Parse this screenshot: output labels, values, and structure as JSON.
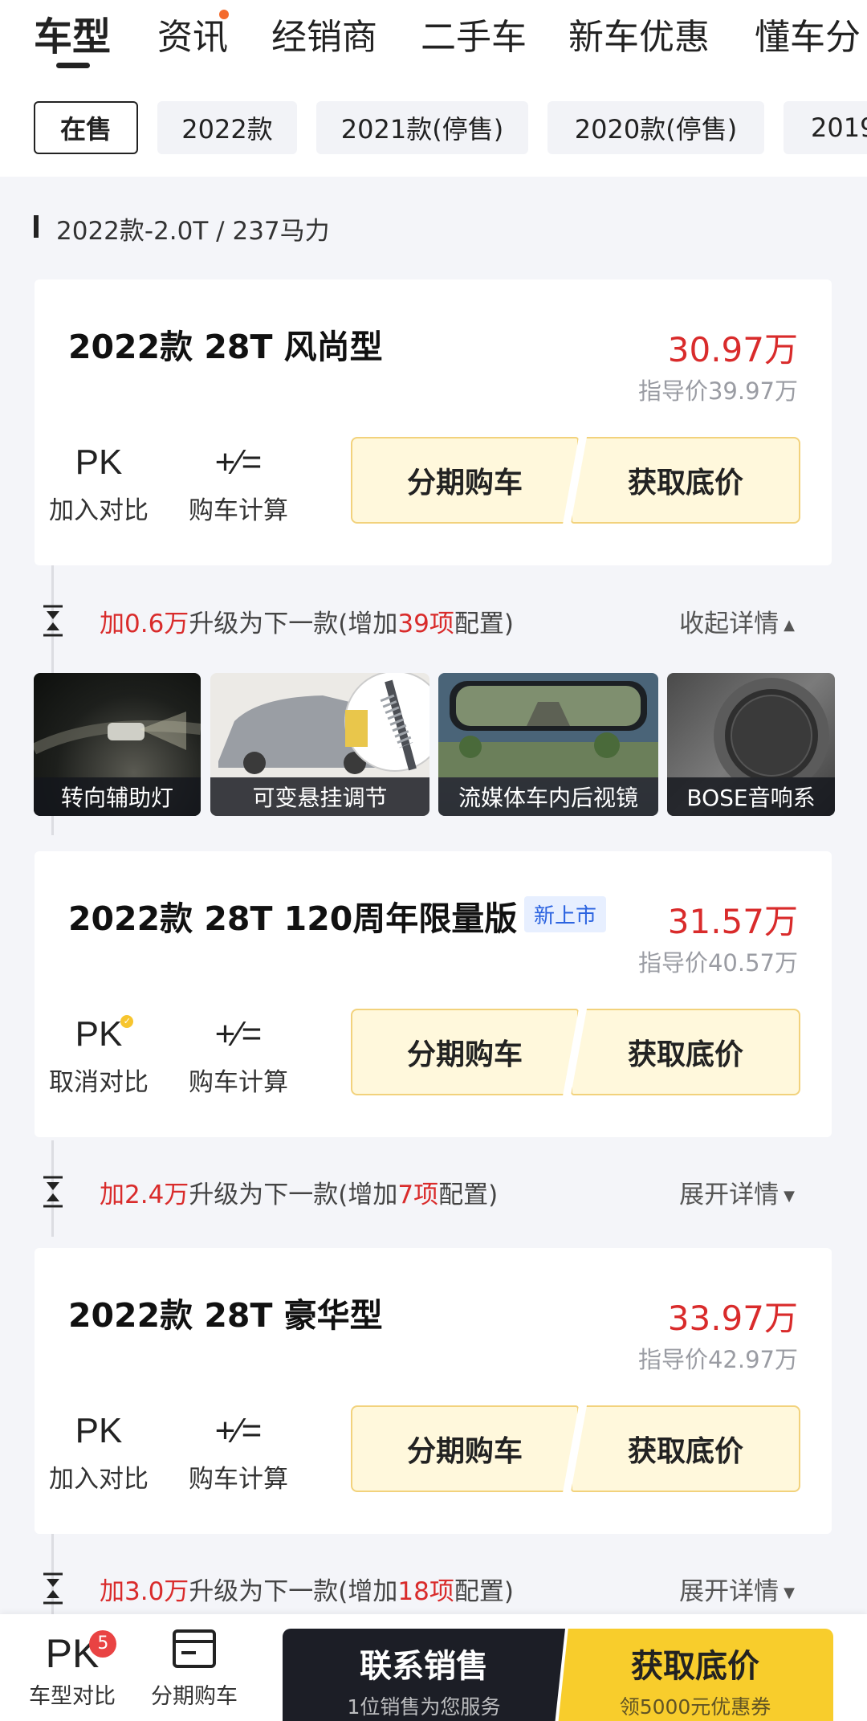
{
  "top_nav": {
    "items": [
      "车型",
      "资讯",
      "经销商",
      "二手车",
      "新车优惠",
      "懂车分"
    ]
  },
  "year_tabs": [
    "在售",
    "2022款",
    "2021款(停售)",
    "2020款(停售)",
    "2019"
  ],
  "section": {
    "label": "2022款-2.0T / 237马力"
  },
  "cards": [
    {
      "title": "2022款 28T 风尚型",
      "price": "30.97万",
      "guide": "指导价39.97万",
      "pk_label": "加入对比",
      "calc_label": "购车计算",
      "installment_label": "分期购车",
      "quote_label": "获取底价"
    },
    {
      "title": "2022款 28T 120周年限量版",
      "badge": "新上市",
      "price": "31.57万",
      "guide": "指导价40.57万",
      "pk_label": "取消对比",
      "calc_label": "购车计算",
      "installment_label": "分期购车",
      "quote_label": "获取底价"
    },
    {
      "title": "2022款 28T 豪华型",
      "price": "33.97万",
      "guide": "指导价42.97万",
      "pk_label": "加入对比",
      "calc_label": "购车计算",
      "installment_label": "分期购车",
      "quote_label": "获取底价"
    }
  ],
  "upgrades": [
    {
      "prefix": "加",
      "amount": "0.6万",
      "middle": "升级为下一款(增加",
      "count": "39项",
      "suffix": "配置)",
      "toggle": "收起详情",
      "arrow": "▲"
    },
    {
      "prefix": "加",
      "amount": "2.4万",
      "middle": "升级为下一款(增加",
      "count": "7项",
      "suffix": "配置)",
      "toggle": "展开详情",
      "arrow": "▼"
    },
    {
      "prefix": "加",
      "amount": "3.0万",
      "middle": "升级为下一款(增加",
      "count": "18项",
      "suffix": "配置)",
      "toggle": "展开详情",
      "arrow": "▼"
    }
  ],
  "gallery": [
    "转向辅助灯",
    "可变悬挂调节",
    "流媒体车内后视镜",
    "BOSE音响系"
  ],
  "bottom_bar": {
    "pk_count": "5",
    "pk_label": "车型对比",
    "installment_label": "分期购车",
    "contact_main": "联系销售",
    "contact_sub": "1位销售为您服务",
    "quote_main": "获取底价",
    "quote_sub": "领5000元优惠券"
  },
  "icons": {
    "pk": "PK",
    "calc": "+⁄="
  },
  "colors": {
    "price_red": "#d92b2b",
    "button_yellow_bg": "#fff8dc",
    "cta_yellow": "#f8cd2c",
    "cta_dark": "#1c1e26"
  }
}
